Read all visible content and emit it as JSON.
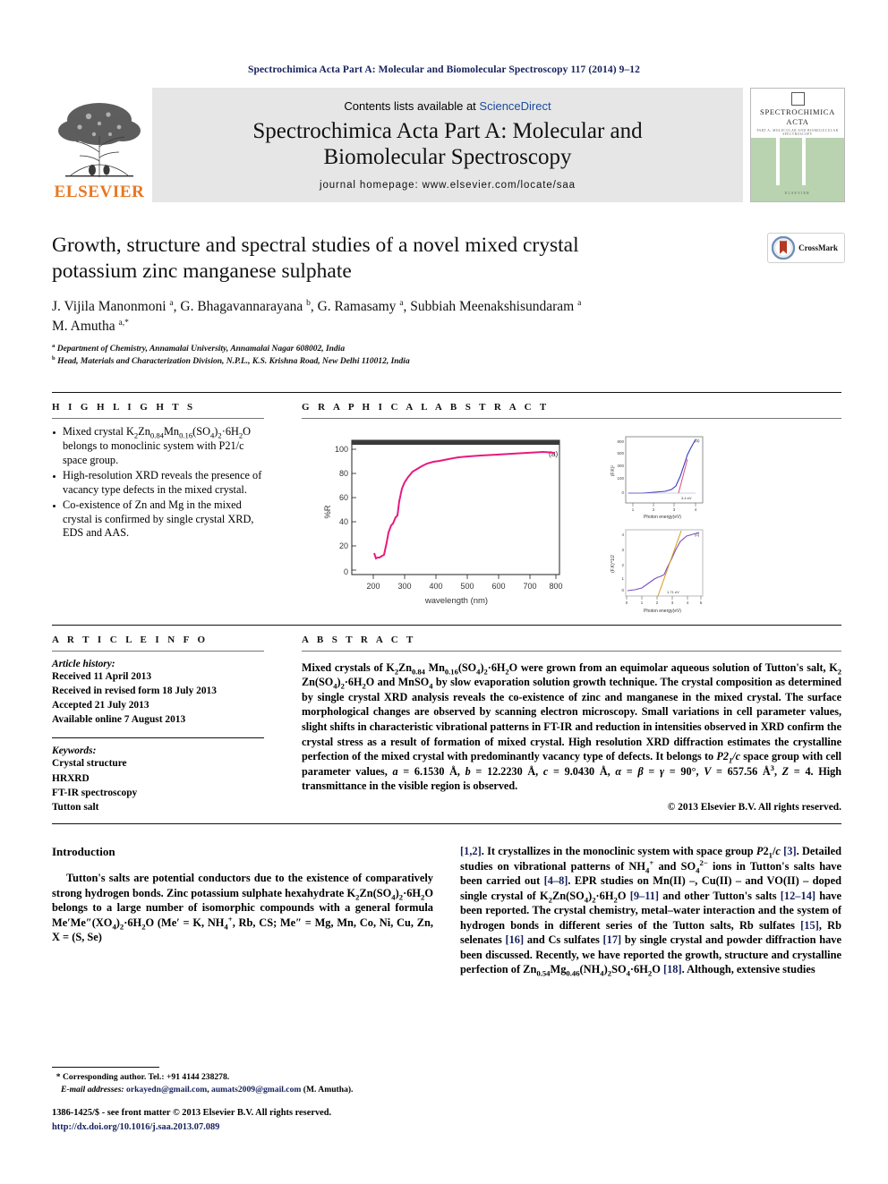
{
  "running_head": "Spectrochimica Acta Part A: Molecular and Biomolecular Spectroscopy 117 (2014) 9–12",
  "banner": {
    "contents_prefix": "Contents lists available at ",
    "sciencedirect": "ScienceDirect",
    "journal_title_line1": "Spectrochimica Acta Part A: Molecular and",
    "journal_title_line2": "Biomolecular Spectroscopy",
    "homepage": "journal homepage: www.elsevier.com/locate/saa",
    "publisher": "ELSEVIER",
    "cover_title_line1": "SPECTROCHIMICA",
    "cover_title_line2": "ACTA",
    "cover_subtitle": "PART A: MOLECULAR AND BIOMOLECULAR SPECTROSCOPY",
    "cover_footer": "ELSEVIER"
  },
  "title": {
    "line1": "Growth, structure and spectral studies of a novel mixed crystal",
    "line2": "potassium zinc manganese sulphate"
  },
  "crossmark": {
    "label": "CrossMark"
  },
  "authors": "J. Vijila Manonmoni a, G. Bhagavannarayana b, G. Ramasamy a, Subbiah Meenakshisundaram a M. Amutha a,*",
  "affiliations": [
    "Department of Chemistry, Annamalai University, Annamalai Nagar 608002, India",
    "Head, Materials and Characterization Division, N.P.L., K.S. Krishna Road, New Delhi 110012, India"
  ],
  "highlights": {
    "heading": "H I G H L I G H T S",
    "items": [
      "Mixed crystal K2Zn0.84Mn0.16(SO4)2·6H2O belongs to monoclinic system with P21/c space group.",
      "High-resolution XRD reveals the presence of vacancy type defects in the mixed crystal.",
      "Co-existence of Zn and Mg in the mixed crystal is confirmed by single crystal XRD, EDS and AAS."
    ]
  },
  "graphical_abstract": {
    "heading": "G R A P H I C A L   A B S T R A C T"
  },
  "article_info": {
    "heading": "A R T I C L E   I N F O",
    "history_label": "Article history:",
    "history": [
      "Received 11 April 2013",
      "Received in revised form 18 July 2013",
      "Accepted 21 July 2013",
      "Available online 7 August 2013"
    ],
    "keywords_label": "Keywords:",
    "keywords": [
      "Crystal structure",
      "HRXRD",
      "FT-IR spectroscopy",
      "Tutton salt"
    ]
  },
  "abstract": {
    "heading": "A B S T R A C T",
    "text": "Mixed crystals of K2Zn0.84 Mn0.16(SO4)2·6H2O were grown from an equimolar aqueous solution of Tutton's salt, K2 Zn(SO4)2·6H2O and MnSO4 by slow evaporation solution growth technique. The crystal composition as determined by single crystal XRD analysis reveals the co-existence of zinc and manganese in the mixed crystal. The surface morphological changes are observed by scanning electron microscopy. Small variations in cell parameter values, slight shifts in characteristic vibrational patterns in FT-IR and reduction in intensities observed in XRD confirm the crystal stress as a result of formation of mixed crystal. High resolution XRD diffraction estimates the crystalline perfection of the mixed crystal with predominantly vacancy type of defects. It belongs to P21/c space group with cell parameter values, a = 6.1530 Å, b = 12.2230 Å, c = 9.0430 Å, α = β = γ = 90°, V = 657.56 Å3, Z = 4. High transmittance in the visible region is observed.",
    "copyright": "© 2013 Elsevier B.V. All rights reserved."
  },
  "body": {
    "intro_heading": "Introduction",
    "left_column": "Tutton's salts are potential conductors due to the existence of comparatively strong hydrogen bonds. Zinc potassium sulphate hexahydrate K2Zn(SO4)2·6H2O belongs to a large number of isomorphic compounds with a general formula Me′Me″(XO4)2·6H2O (Me′ = K, NH4+, Rb, CS; Me″ = Mg, Mn, Co, Ni, Cu, Zn, X = (S, Se)",
    "right_column": "[1,2]. It crystallizes in the monoclinic system with space group P21/c [3]. Detailed studies on vibrational patterns of NH4+ and SO42− ions in Tutton's salts have been carried out [4–8]. EPR studies on Mn(II) –, Cu(II) – and VO(II) – doped single crystal of K2Zn(SO4)2·6H2O [9–11] and other Tutton's salts [12–14] have been reported. The crystal chemistry, metal–water interaction and the system of hydrogen bonds in different series of the Tutton salts, Rb sulfates [15], Rb selenates [16] and Cs sulfates [17] by single crystal and powder diffraction have been discussed. Recently, we have reported the growth, structure and crystalline perfection of Zn0.54Mg0.46(NH4)2SO4·6H2O [18]. Although, extensive studies"
  },
  "footnotes": {
    "corresponding": "Corresponding author. Tel.: +91 4144 238278.",
    "email_label": "E-mail addresses:",
    "email1": "orkayedn@gmail.com",
    "email2": "aumats2009@gmail.com",
    "email_owner": "(M. Amutha)."
  },
  "imprint": {
    "line1": "1386-1425/$ - see front matter © 2013 Elsevier B.V. All rights reserved.",
    "doi": "http://dx.doi.org/10.1016/j.saa.2013.07.089"
  },
  "colors": {
    "elsevier_orange": "#e87722",
    "link_blue": "#16205c",
    "sciencedirect_blue": "#1a4b9c",
    "curve_pink": "#e8197f",
    "curve_blue": "#3a3ac0",
    "curve_purple": "#7b4fbf",
    "curve_orange": "#d79a20",
    "cover_green": "#b9d3b0"
  },
  "chart_data": [
    {
      "type": "line",
      "panel": "a",
      "title": "",
      "xlabel": "wavelength (nm)",
      "ylabel": "%R",
      "xlim": [
        150,
        840
      ],
      "ylim": [
        0,
        110
      ],
      "xticks": [
        200,
        300,
        400,
        500,
        600,
        700,
        800
      ],
      "yticks": [
        0,
        20,
        40,
        60,
        80,
        100
      ],
      "grid": false,
      "legend": "(a)",
      "series": [
        {
          "name": "%R",
          "color": "#e8197f",
          "x": [
            205,
            212,
            218,
            225,
            232,
            240,
            248,
            255,
            262,
            270,
            278,
            285,
            292,
            300,
            310,
            320,
            335,
            350,
            365,
            380,
            400,
            420,
            450,
            480,
            510,
            550,
            600,
            650,
            700,
            750,
            790
          ],
          "y": [
            14,
            10,
            11,
            11,
            12,
            13,
            23,
            31,
            37,
            38,
            44,
            45,
            57,
            68,
            74,
            78,
            82,
            84,
            86,
            88,
            89,
            90,
            91,
            92,
            93,
            94,
            94.5,
            95,
            95.5,
            96,
            95.5
          ]
        }
      ]
    },
    {
      "type": "line",
      "panel": "b",
      "title": "",
      "xlabel": "Photon energy (eV)",
      "ylabel": "(F.K)²",
      "xlim": [
        1,
        4
      ],
      "ylim": [
        0,
        900
      ],
      "xticks": [
        1,
        2,
        3,
        4
      ],
      "yticks": [
        0,
        100,
        300,
        500,
        800
      ],
      "grid": false,
      "legend": "(b)",
      "annotation": "3.4 eV",
      "series": [
        {
          "name": "(F.K)²",
          "color": "#3a3ac0",
          "x": [
            1.0,
            1.5,
            2.0,
            2.5,
            2.8,
            3.0,
            3.2,
            3.35,
            3.5,
            3.65,
            3.8,
            3.95
          ],
          "y": [
            5,
            5,
            6,
            8,
            14,
            25,
            60,
            180,
            330,
            520,
            700,
            860
          ]
        },
        {
          "name": "tangent",
          "color": "#d94f7a",
          "x": [
            3.18,
            3.62
          ],
          "y": [
            0,
            420
          ]
        }
      ]
    },
    {
      "type": "line",
      "panel": "c",
      "title": "",
      "xlabel": "Photon energy (eV)",
      "ylabel": "(F.K)^1/2",
      "xlim": [
        0,
        5
      ],
      "ylim": [
        0,
        4.5
      ],
      "xticks": [
        0,
        1,
        2,
        3,
        4,
        5
      ],
      "yticks": [
        0,
        1,
        2,
        3,
        4
      ],
      "grid": false,
      "legend": "(c)",
      "annotation": "1.71 eV",
      "series": [
        {
          "name": "(F.K)^1/2",
          "color": "#7b4fbf",
          "x": [
            0.1,
            0.5,
            1.0,
            1.4,
            1.7,
            1.95,
            2.1,
            2.3,
            2.5,
            2.8,
            3.1,
            3.4,
            3.8,
            4.2,
            4.6
          ],
          "y": [
            0.25,
            0.28,
            0.38,
            0.6,
            0.9,
            1.05,
            1.05,
            1.15,
            1.5,
            2.1,
            2.8,
            3.35,
            3.7,
            3.85,
            4.0
          ]
        },
        {
          "name": "tangent",
          "color": "#d79a20",
          "x": [
            2.05,
            3.6
          ],
          "y": [
            0,
            4.4
          ]
        }
      ]
    }
  ]
}
